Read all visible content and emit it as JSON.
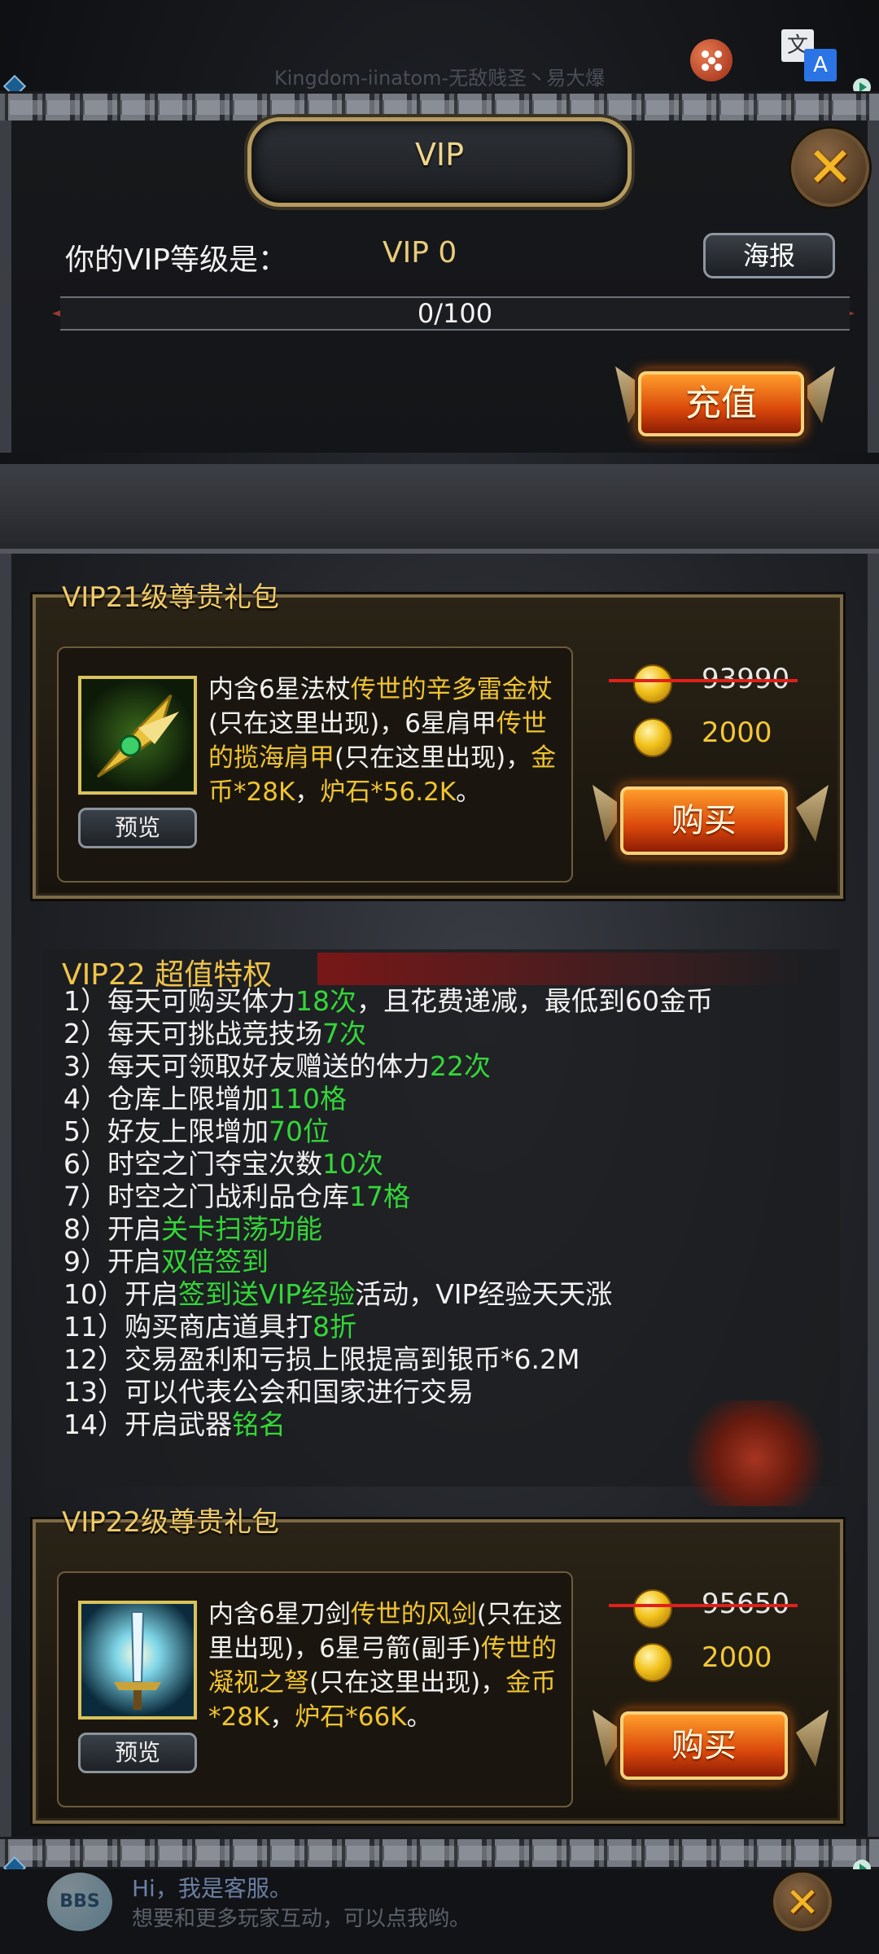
{
  "status": {
    "watermark": "Kingdom-iinatom-无敌贱圣丶易大爆"
  },
  "header": {
    "title": "VIP",
    "vip_label": "你的VIP等级是：",
    "vip_level": "VIP 0",
    "poster_label": "海报",
    "progress_text": "0/100",
    "progress_fraction": 0,
    "recharge_label": "充值"
  },
  "gifts": [
    {
      "title": "VIP21级尊贵礼包",
      "desc_parts": [
        {
          "t": "内含6星法杖",
          "c": "w"
        },
        {
          "t": "传世的辛多雷金杖",
          "c": "y"
        },
        {
          "t": "(只在这里出现)，6星肩甲",
          "c": "w"
        },
        {
          "t": "传世的揽海肩甲",
          "c": "y"
        },
        {
          "t": "(只在这里出现)，",
          "c": "w"
        },
        {
          "t": "金币*28K",
          "c": "y"
        },
        {
          "t": "，",
          "c": "w"
        },
        {
          "t": "炉石*56.2K",
          "c": "y"
        },
        {
          "t": "。",
          "c": "w"
        }
      ],
      "preview_label": "预览",
      "old_price": "93990",
      "new_price": "2000",
      "buy_label": "购买"
    },
    {
      "title": "VIP22级尊贵礼包",
      "desc_parts": [
        {
          "t": "内含6星刀剑",
          "c": "w"
        },
        {
          "t": "传世的风剑",
          "c": "y"
        },
        {
          "t": "(只在这里出现)，6星弓箭(副手)",
          "c": "w"
        },
        {
          "t": "传世的凝视之弩",
          "c": "y"
        },
        {
          "t": "(只在这里出现)，",
          "c": "w"
        },
        {
          "t": "金币*28K",
          "c": "y"
        },
        {
          "t": "，",
          "c": "w"
        },
        {
          "t": "炉石*66K",
          "c": "y"
        },
        {
          "t": "。",
          "c": "w"
        }
      ],
      "preview_label": "预览",
      "old_price": "95650",
      "new_price": "2000",
      "buy_label": "购买"
    }
  ],
  "privileges": {
    "title": "VIP22 超值特权",
    "items": [
      [
        {
          "t": "1）每天可购买体力",
          "c": "w"
        },
        {
          "t": "18次",
          "c": "g"
        },
        {
          "t": "，且花费递减，最低到60金币",
          "c": "w"
        }
      ],
      [
        {
          "t": "2）每天可挑战竞技场",
          "c": "w"
        },
        {
          "t": "7次",
          "c": "g"
        }
      ],
      [
        {
          "t": "3）每天可领取好友赠送的体力",
          "c": "w"
        },
        {
          "t": "22次",
          "c": "g"
        }
      ],
      [
        {
          "t": "4）仓库上限增加",
          "c": "w"
        },
        {
          "t": "110格",
          "c": "g"
        }
      ],
      [
        {
          "t": "5）好友上限增加",
          "c": "w"
        },
        {
          "t": "70位",
          "c": "g"
        }
      ],
      [
        {
          "t": "6）时空之门夺宝次数",
          "c": "w"
        },
        {
          "t": "10次",
          "c": "g"
        }
      ],
      [
        {
          "t": "7）时空之门战利品仓库",
          "c": "w"
        },
        {
          "t": "17格",
          "c": "g"
        }
      ],
      [
        {
          "t": "8）开启",
          "c": "w"
        },
        {
          "t": "关卡扫荡功能",
          "c": "g"
        }
      ],
      [
        {
          "t": "9）开启",
          "c": "w"
        },
        {
          "t": "双倍签到",
          "c": "g"
        }
      ],
      [
        {
          "t": "10）开启",
          "c": "w"
        },
        {
          "t": "签到送VIP经验",
          "c": "g"
        },
        {
          "t": "活动，VIP经验天天涨",
          "c": "w"
        }
      ],
      [
        {
          "t": "11）购买商店道具打",
          "c": "w"
        },
        {
          "t": "8折",
          "c": "g"
        }
      ],
      [
        {
          "t": "12）交易盈利和亏损上限提高到银币*6.2M",
          "c": "w"
        }
      ],
      [
        {
          "t": "13）可以代表公会和国家进行交易",
          "c": "w"
        }
      ],
      [
        {
          "t": "14）开启武器",
          "c": "w"
        },
        {
          "t": "铭名",
          "c": "g"
        }
      ]
    ]
  },
  "customer_service": {
    "bbs_label": "BBS",
    "hi": "Hi，我是客服。",
    "message": "想要和更多玩家互动，可以点我哟。"
  },
  "colors": {
    "gold": "#f0c430",
    "green": "#34d639",
    "accent_orange": "#d9470b"
  }
}
